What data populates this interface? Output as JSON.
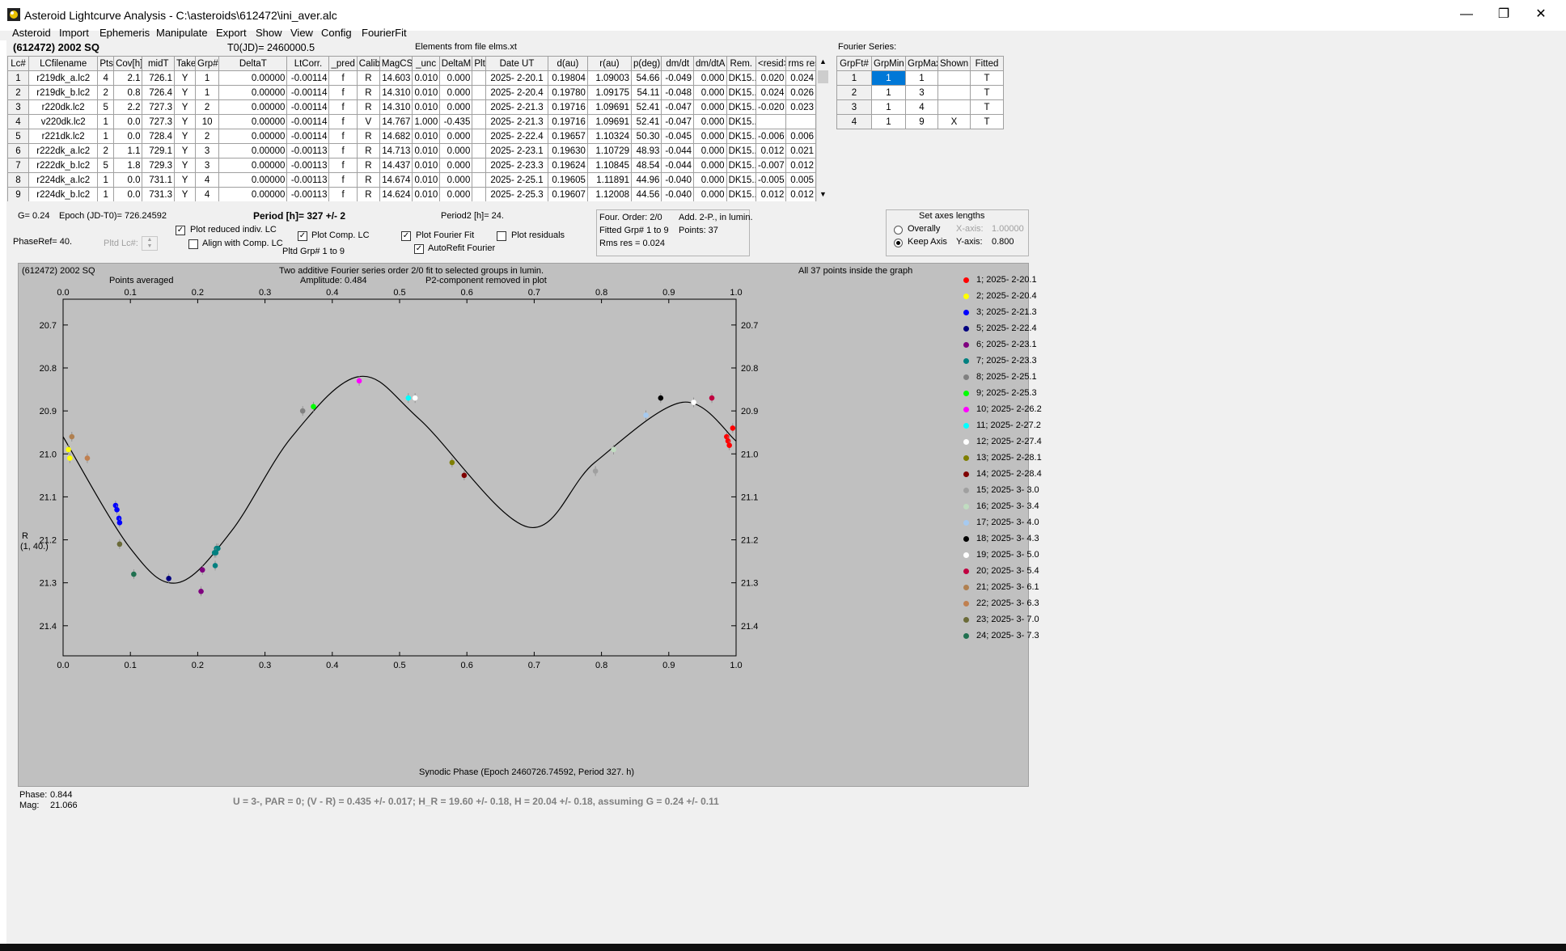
{
  "window": {
    "title": "Asteroid Lightcurve Analysis - C:\\asteroids\\612472\\ini_aver.alc"
  },
  "menu": [
    "Asteroid",
    "Import",
    "Ephemeris",
    "Manipulate",
    "Export",
    "Show",
    "View",
    "Config",
    "FourierFit"
  ],
  "header": {
    "object": "(612472) 2002 SQ",
    "t0": "T0(JD)= 2460000.5",
    "elements": "Elements from file elms.xt",
    "fourier_title": "Fourier Series:"
  },
  "lc_table": {
    "columns": [
      "Lc#",
      "LCfilename",
      "Pts",
      "Cov[h]",
      "midT",
      "Take",
      "Grp#",
      "DeltaT",
      "LtCorr.",
      "_pred",
      "Calib.",
      "MagCS",
      "_unc",
      "DeltaM",
      "Plt",
      "Date UT",
      "d(au)",
      "r(au)",
      "p(deg)",
      "dm/dt",
      "dm/dtA",
      "Rem.",
      "<resid>",
      "rms res"
    ],
    "rows": [
      [
        "1",
        "r219dk_a.lc2",
        "4",
        "2.1",
        "726.1",
        "Y",
        "1",
        "0.00000",
        "-0.00114",
        "f",
        "R",
        "14.603",
        "0.010",
        "0.000",
        "",
        "2025- 2-20.1",
        "0.19804",
        "1.09003",
        "54.66",
        "-0.049",
        "0.000",
        "DK15..",
        "0.020",
        "0.024"
      ],
      [
        "2",
        "r219dk_b.lc2",
        "2",
        "0.8",
        "726.4",
        "Y",
        "1",
        "0.00000",
        "-0.00114",
        "f",
        "R",
        "14.310",
        "0.010",
        "0.000",
        "",
        "2025- 2-20.4",
        "0.19780",
        "1.09175",
        "54.11",
        "-0.048",
        "0.000",
        "DK15..",
        "0.024",
        "0.026"
      ],
      [
        "3",
        "r220dk.lc2",
        "5",
        "2.2",
        "727.3",
        "Y",
        "2",
        "0.00000",
        "-0.00114",
        "f",
        "R",
        "14.310",
        "0.010",
        "0.000",
        "",
        "2025- 2-21.3",
        "0.19716",
        "1.09691",
        "52.41",
        "-0.047",
        "0.000",
        "DK15..",
        "-0.020",
        "0.023"
      ],
      [
        "4",
        "v220dk.lc2",
        "1",
        "0.0",
        "727.3",
        "Y",
        "10",
        "0.00000",
        "-0.00114",
        "f",
        "V",
        "14.767",
        "1.000",
        "-0.435",
        "",
        "2025- 2-21.3",
        "0.19716",
        "1.09691",
        "52.41",
        "-0.047",
        "0.000",
        "DK15..",
        "",
        ""
      ],
      [
        "5",
        "r221dk.lc2",
        "1",
        "0.0",
        "728.4",
        "Y",
        "2",
        "0.00000",
        "-0.00114",
        "f",
        "R",
        "14.682",
        "0.010",
        "0.000",
        "",
        "2025- 2-22.4",
        "0.19657",
        "1.10324",
        "50.30",
        "-0.045",
        "0.000",
        "DK15..",
        "-0.006",
        "0.006"
      ],
      [
        "6",
        "r222dk_a.lc2",
        "2",
        "1.1",
        "729.1",
        "Y",
        "3",
        "0.00000",
        "-0.00113",
        "f",
        "R",
        "14.713",
        "0.010",
        "0.000",
        "",
        "2025- 2-23.1",
        "0.19630",
        "1.10729",
        "48.93",
        "-0.044",
        "0.000",
        "DK15..",
        "0.012",
        "0.021"
      ],
      [
        "7",
        "r222dk_b.lc2",
        "5",
        "1.8",
        "729.3",
        "Y",
        "3",
        "0.00000",
        "-0.00113",
        "f",
        "R",
        "14.437",
        "0.010",
        "0.000",
        "",
        "2025- 2-23.3",
        "0.19624",
        "1.10845",
        "48.54",
        "-0.044",
        "0.000",
        "DK15..",
        "-0.007",
        "0.012"
      ],
      [
        "8",
        "r224dk_a.lc2",
        "1",
        "0.0",
        "731.1",
        "Y",
        "4",
        "0.00000",
        "-0.00113",
        "f",
        "R",
        "14.674",
        "0.010",
        "0.000",
        "",
        "2025- 2-25.1",
        "0.19605",
        "1.11891",
        "44.96",
        "-0.040",
        "0.000",
        "DK15..",
        "-0.005",
        "0.005"
      ],
      [
        "9",
        "r224dk_b.lc2",
        "1",
        "0.0",
        "731.3",
        "Y",
        "4",
        "0.00000",
        "-0.00113",
        "f",
        "R",
        "14.624",
        "0.010",
        "0.000",
        "",
        "2025- 2-25.3",
        "0.19607",
        "1.12008",
        "44.56",
        "-0.040",
        "0.000",
        "DK15..",
        "0.012",
        "0.012"
      ]
    ]
  },
  "fourier_table": {
    "columns": [
      "GrpFt#",
      "GrpMin",
      "GrpMax",
      "Shown",
      "Fitted"
    ],
    "rows": [
      [
        "1",
        "1",
        "1",
        "",
        "T"
      ],
      [
        "2",
        "1",
        "3",
        "",
        "T"
      ],
      [
        "3",
        "1",
        "4",
        "",
        "T"
      ],
      [
        "4",
        "1",
        "9",
        "X",
        "T"
      ]
    ]
  },
  "controls": {
    "g": "G= 0.24",
    "epoch": "Epoch (JD-T0)= 726.24592",
    "period": "Period [h]= 327 +/- 2",
    "period2": "Period2 [h]= 24.",
    "phaseref": "PhaseRef= 40.",
    "pltd_lc": "Pltd Lc#:",
    "plot_reduced": "Plot reduced indiv. LC",
    "align_comp": "Align with Comp. LC",
    "plot_comp": "Plot Comp. LC",
    "pltd_grp": "Pltd Grp#  1  to  9",
    "plot_fourier": "Plot Fourier Fit",
    "autorefit": "AutoRefit Fourier",
    "plot_residuals": "Plot residuals",
    "four_order": "Four. Order:  2/0",
    "add_info": "Add. 2-P., in lumin.",
    "fitted_grp": "Fitted Grp# 1 to 9",
    "points": "Points: 37",
    "rms": "Rms res     = 0.024",
    "axes_title": "Set axes lengths",
    "overall": "Overally",
    "keep_axis": "Keep Axis",
    "xaxis_label": "X-axis:",
    "xaxis_value": "1.00000",
    "yaxis_label": "Y-axis:",
    "yaxis_value": "0.800"
  },
  "plot": {
    "object": "(612472) 2002 SQ",
    "points_averaged": "Points averaged",
    "desc1": "Two additive Fourier series order 2/0 fit to selected groups in lumin.",
    "desc2": "Amplitude: 0.484",
    "desc3": "P2-component removed in plot",
    "inside": "All 37 points inside the graph",
    "ylabel1": "R",
    "ylabel2": "(1, 40.)",
    "xlabel": "Synodic Phase (Epoch 2460726.74592, Period 327. h)"
  },
  "chart_data": {
    "type": "scatter",
    "x_ticks": [
      "0.0",
      "0.1",
      "0.2",
      "0.3",
      "0.4",
      "0.5",
      "0.6",
      "0.7",
      "0.8",
      "0.9",
      "1.0"
    ],
    "y_ticks": [
      "20.7",
      "20.8",
      "20.9",
      "21.0",
      "21.1",
      "21.2",
      "21.3",
      "21.4"
    ],
    "xlim": [
      0,
      1.0
    ],
    "ylim": [
      21.47,
      20.64
    ],
    "y_inverted": true,
    "grid": false,
    "fourier_curve": [
      [
        0,
        20.96
      ],
      [
        0.1,
        21.22
      ],
      [
        0.17,
        21.3
      ],
      [
        0.25,
        21.18
      ],
      [
        0.34,
        20.96
      ],
      [
        0.44,
        20.82
      ],
      [
        0.53,
        20.92
      ],
      [
        0.69,
        21.17
      ],
      [
        0.79,
        21.02
      ],
      [
        0.92,
        20.88
      ],
      [
        1.0,
        20.97
      ]
    ],
    "series": [
      {
        "name": "1; 2025- 2-20.1",
        "color": "#ff0000",
        "points": [
          [
            0.986,
            20.96
          ],
          [
            0.988,
            20.97
          ],
          [
            0.99,
            20.98
          ],
          [
            0.995,
            20.94
          ]
        ]
      },
      {
        "name": "2; 2025- 2-20.4",
        "color": "#ffff00",
        "points": [
          [
            0.008,
            20.99
          ],
          [
            0.01,
            21.01
          ]
        ]
      },
      {
        "name": "3; 2025- 2-21.3",
        "color": "#0000ff",
        "points": [
          [
            0.078,
            21.12
          ],
          [
            0.08,
            21.13
          ],
          [
            0.083,
            21.15
          ],
          [
            0.084,
            21.16
          ]
        ]
      },
      {
        "name": "5; 2025- 2-22.4",
        "color": "#00007f",
        "points": [
          [
            0.157,
            21.29
          ]
        ]
      },
      {
        "name": "6; 2025- 2-23.1",
        "color": "#7f007f",
        "points": [
          [
            0.207,
            21.27
          ],
          [
            0.205,
            21.32
          ]
        ]
      },
      {
        "name": "7; 2025- 2-23.3",
        "color": "#008080",
        "points": [
          [
            0.225,
            21.23
          ],
          [
            0.228,
            21.22
          ],
          [
            0.226,
            21.26
          ],
          [
            0.23,
            21.22
          ],
          [
            0.227,
            21.23
          ]
        ]
      },
      {
        "name": "8; 2025- 2-25.1",
        "color": "#808080",
        "points": [
          [
            0.356,
            20.9
          ]
        ]
      },
      {
        "name": "9; 2025- 2-25.3",
        "color": "#00ff00",
        "points": [
          [
            0.372,
            20.89
          ]
        ]
      },
      {
        "name": "10; 2025- 2-26.2",
        "color": "#ff00ff",
        "points": [
          [
            0.44,
            20.83
          ]
        ]
      },
      {
        "name": "11; 2025- 2-27.2",
        "color": "#00ffff",
        "points": [
          [
            0.513,
            20.87
          ]
        ]
      },
      {
        "name": "12; 2025- 2-27.4",
        "color": "#ffffff",
        "points": [
          [
            0.523,
            20.87
          ]
        ]
      },
      {
        "name": "13; 2025- 2-28.1",
        "color": "#7f7f00",
        "points": [
          [
            0.578,
            21.02
          ]
        ]
      },
      {
        "name": "14; 2025- 2-28.4",
        "color": "#7f0000",
        "points": [
          [
            0.596,
            21.05
          ]
        ]
      },
      {
        "name": "15; 2025- 3- 3.0",
        "color": "#a0a0a0",
        "points": [
          [
            0.791,
            21.04
          ]
        ]
      },
      {
        "name": "16; 2025- 3- 3.4",
        "color": "#c0dcc0",
        "points": [
          [
            0.818,
            20.99
          ]
        ]
      },
      {
        "name": "17; 2025- 3- 4.0",
        "color": "#a6caf0",
        "points": [
          [
            0.866,
            20.91
          ]
        ]
      },
      {
        "name": "18; 2025- 3- 4.3",
        "color": "#000000",
        "points": [
          [
            0.888,
            20.87
          ]
        ]
      },
      {
        "name": "19; 2025- 3- 5.0",
        "color": "#ffffff",
        "points": [
          [
            0.937,
            20.88
          ]
        ]
      },
      {
        "name": "20; 2025- 3- 5.4",
        "color": "#c00040",
        "points": [
          [
            0.964,
            20.87
          ]
        ]
      },
      {
        "name": "21; 2025- 3- 6.1",
        "color": "#b08050",
        "points": [
          [
            0.013,
            20.96
          ]
        ]
      },
      {
        "name": "22; 2025- 3- 6.3",
        "color": "#c08050",
        "points": [
          [
            0.036,
            21.01
          ]
        ]
      },
      {
        "name": "23; 2025- 3- 7.0",
        "color": "#6b6b38",
        "points": [
          [
            0.084,
            21.21
          ]
        ]
      },
      {
        "name": "24; 2025- 3- 7.3",
        "color": "#207050",
        "points": [
          [
            0.105,
            21.28
          ]
        ]
      }
    ]
  },
  "status": {
    "phase_label": "Phase:",
    "phase_value": "0.844",
    "mag_label": "Mag:",
    "mag_value": "21.066",
    "result": "U = 3-, PAR = 0; (V - R) = 0.435 +/- 0.017; H_R = 19.60 +/- 0.18, H = 20.04 +/- 0.18, assuming G = 0.24 +/- 0.11"
  }
}
